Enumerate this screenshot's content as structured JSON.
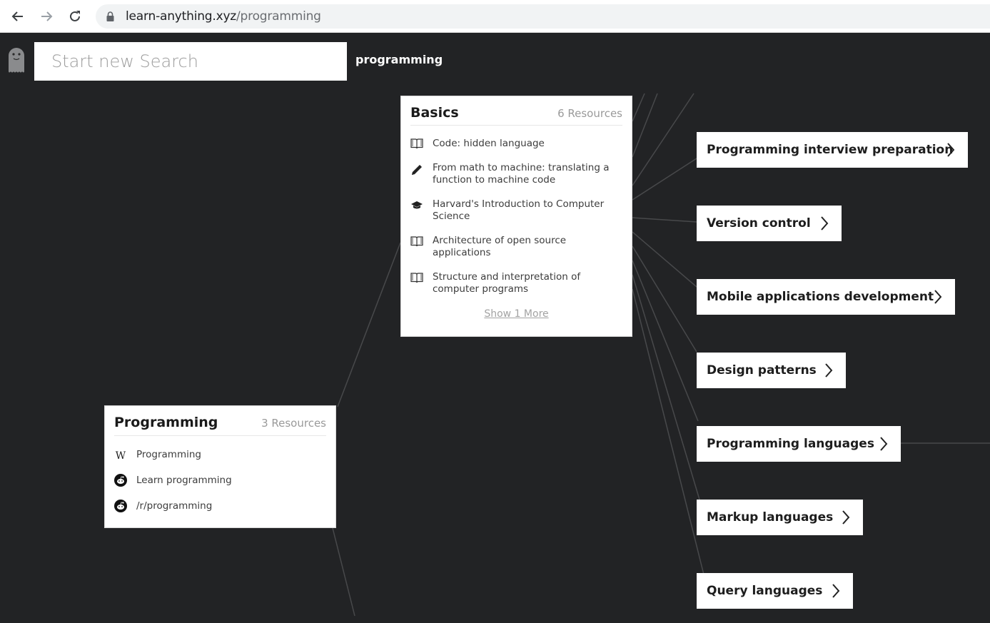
{
  "browser": {
    "url_host": "learn-anything.xyz",
    "url_path": "/programming"
  },
  "header": {
    "search_placeholder": "Start new Search",
    "breadcrumb": "programming"
  },
  "basics_card": {
    "title": "Basics",
    "count": "6 Resources",
    "resources": [
      {
        "icon": "book-icon",
        "label": "Code: hidden language"
      },
      {
        "icon": "pencil-icon",
        "label": "From math to machine: translating a function to machine code"
      },
      {
        "icon": "graduation-cap-icon",
        "label": "Harvard's Introduction to Computer Science"
      },
      {
        "icon": "book-icon",
        "label": "Architecture of open source applications"
      },
      {
        "icon": "book-icon",
        "label": "Structure and interpretation of computer programs"
      }
    ],
    "show_more": "Show 1 More"
  },
  "programming_card": {
    "title": "Programming",
    "count": "3 Resources",
    "resources": [
      {
        "icon": "wikipedia-icon",
        "label": "Programming"
      },
      {
        "icon": "reddit-icon",
        "label": "Learn programming"
      },
      {
        "icon": "reddit-icon",
        "label": "/r/programming"
      }
    ]
  },
  "topics": [
    {
      "label": "Programming interview preparation"
    },
    {
      "label": "Version control"
    },
    {
      "label": "Mobile applications development"
    },
    {
      "label": "Design patterns"
    },
    {
      "label": "Programming languages"
    },
    {
      "label": "Markup languages"
    },
    {
      "label": "Query languages"
    }
  ],
  "colors": {
    "background": "#222325",
    "line": "#4a4b4d",
    "card": "#ffffff"
  }
}
